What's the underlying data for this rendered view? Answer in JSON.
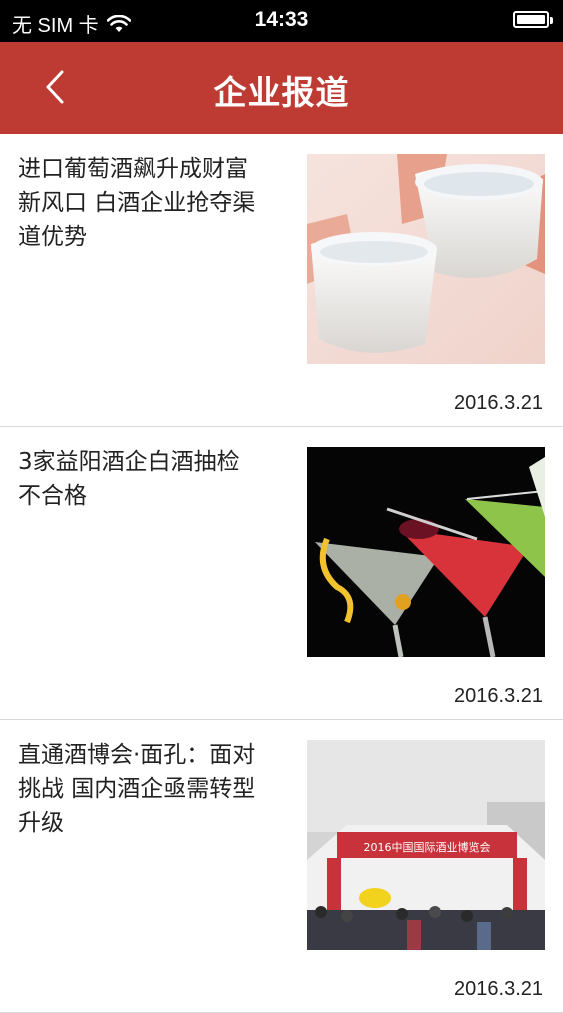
{
  "status_bar": {
    "carrier": "无 SIM 卡",
    "time": "14:33"
  },
  "nav": {
    "title": "企业报道"
  },
  "articles": [
    {
      "title": "进口葡萄酒飙升成财富新风口 白酒企业抢夺渠道优势",
      "date": "2016.3.21",
      "image": "baijiu-cups-photo"
    },
    {
      "title": "3家益阳酒企白酒抽检不合格",
      "date": "2016.3.21",
      "image": "cocktail-glasses-photo"
    },
    {
      "title": "直通酒博会·面孔：面对挑战 国内酒企亟需转型升级",
      "date": "2016.3.21",
      "image": "expo-entrance-photo",
      "image_banner_text": "2016中国国际酒业博览会"
    }
  ]
}
